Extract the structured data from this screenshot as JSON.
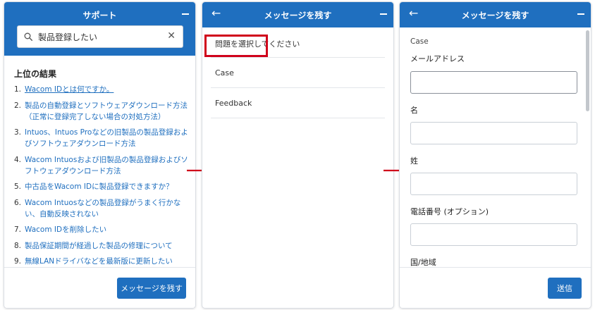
{
  "panel1": {
    "title": "サポート",
    "search": {
      "value": "製品登録したい",
      "placeholder": ""
    },
    "results_heading": "上位の結果",
    "results": [
      {
        "num": "1.",
        "text": "Wacom IDとは何ですか。"
      },
      {
        "num": "2.",
        "text": "製品の自動登録とソフトウェアダウンロード方法（正常に登録完了しない場合の対処方法）"
      },
      {
        "num": "3.",
        "text": "Intuos、Intuos Proなどの旧製品の製品登録およびソフトウェアダウンロード方法"
      },
      {
        "num": "4.",
        "text": "Wacom Intuosおよび旧製品の製品登録およびソフトウェアダウンロード方法"
      },
      {
        "num": "5.",
        "text": "中古品をWacom IDに製品登録できますか？"
      },
      {
        "num": "6.",
        "text": "Wacom Intuosなどの製品登録がうまく行かない、自動反映されない"
      },
      {
        "num": "7.",
        "text": "Wacom IDを削除したい"
      },
      {
        "num": "8.",
        "text": "製品保証期間が経過した製品の修理について"
      },
      {
        "num": "9.",
        "text": "無線LANドライバなどを最新版に更新したい"
      }
    ],
    "button_label": "メッセージを残す"
  },
  "panel2": {
    "title": "メッセージを残す",
    "prompt": "問題を選択してください",
    "topics": [
      "Case",
      "Feedback"
    ]
  },
  "panel3": {
    "title": "メッセージを残す",
    "case_label": "Case",
    "fields": [
      {
        "label": "メールアドレス"
      },
      {
        "label": "名"
      },
      {
        "label": "姓"
      },
      {
        "label": "電話番号 (オプション)"
      },
      {
        "label": "国/地域"
      }
    ],
    "send_label": "送信"
  },
  "icons": {
    "back": "back-arrow-icon",
    "minimize": "minimize-icon",
    "search": "search-icon",
    "clear": "close-icon"
  },
  "colors": {
    "header": "#1f6fbf",
    "link": "#1f6fbf",
    "highlight": "#d0021b",
    "arrow": "#d0021b"
  }
}
